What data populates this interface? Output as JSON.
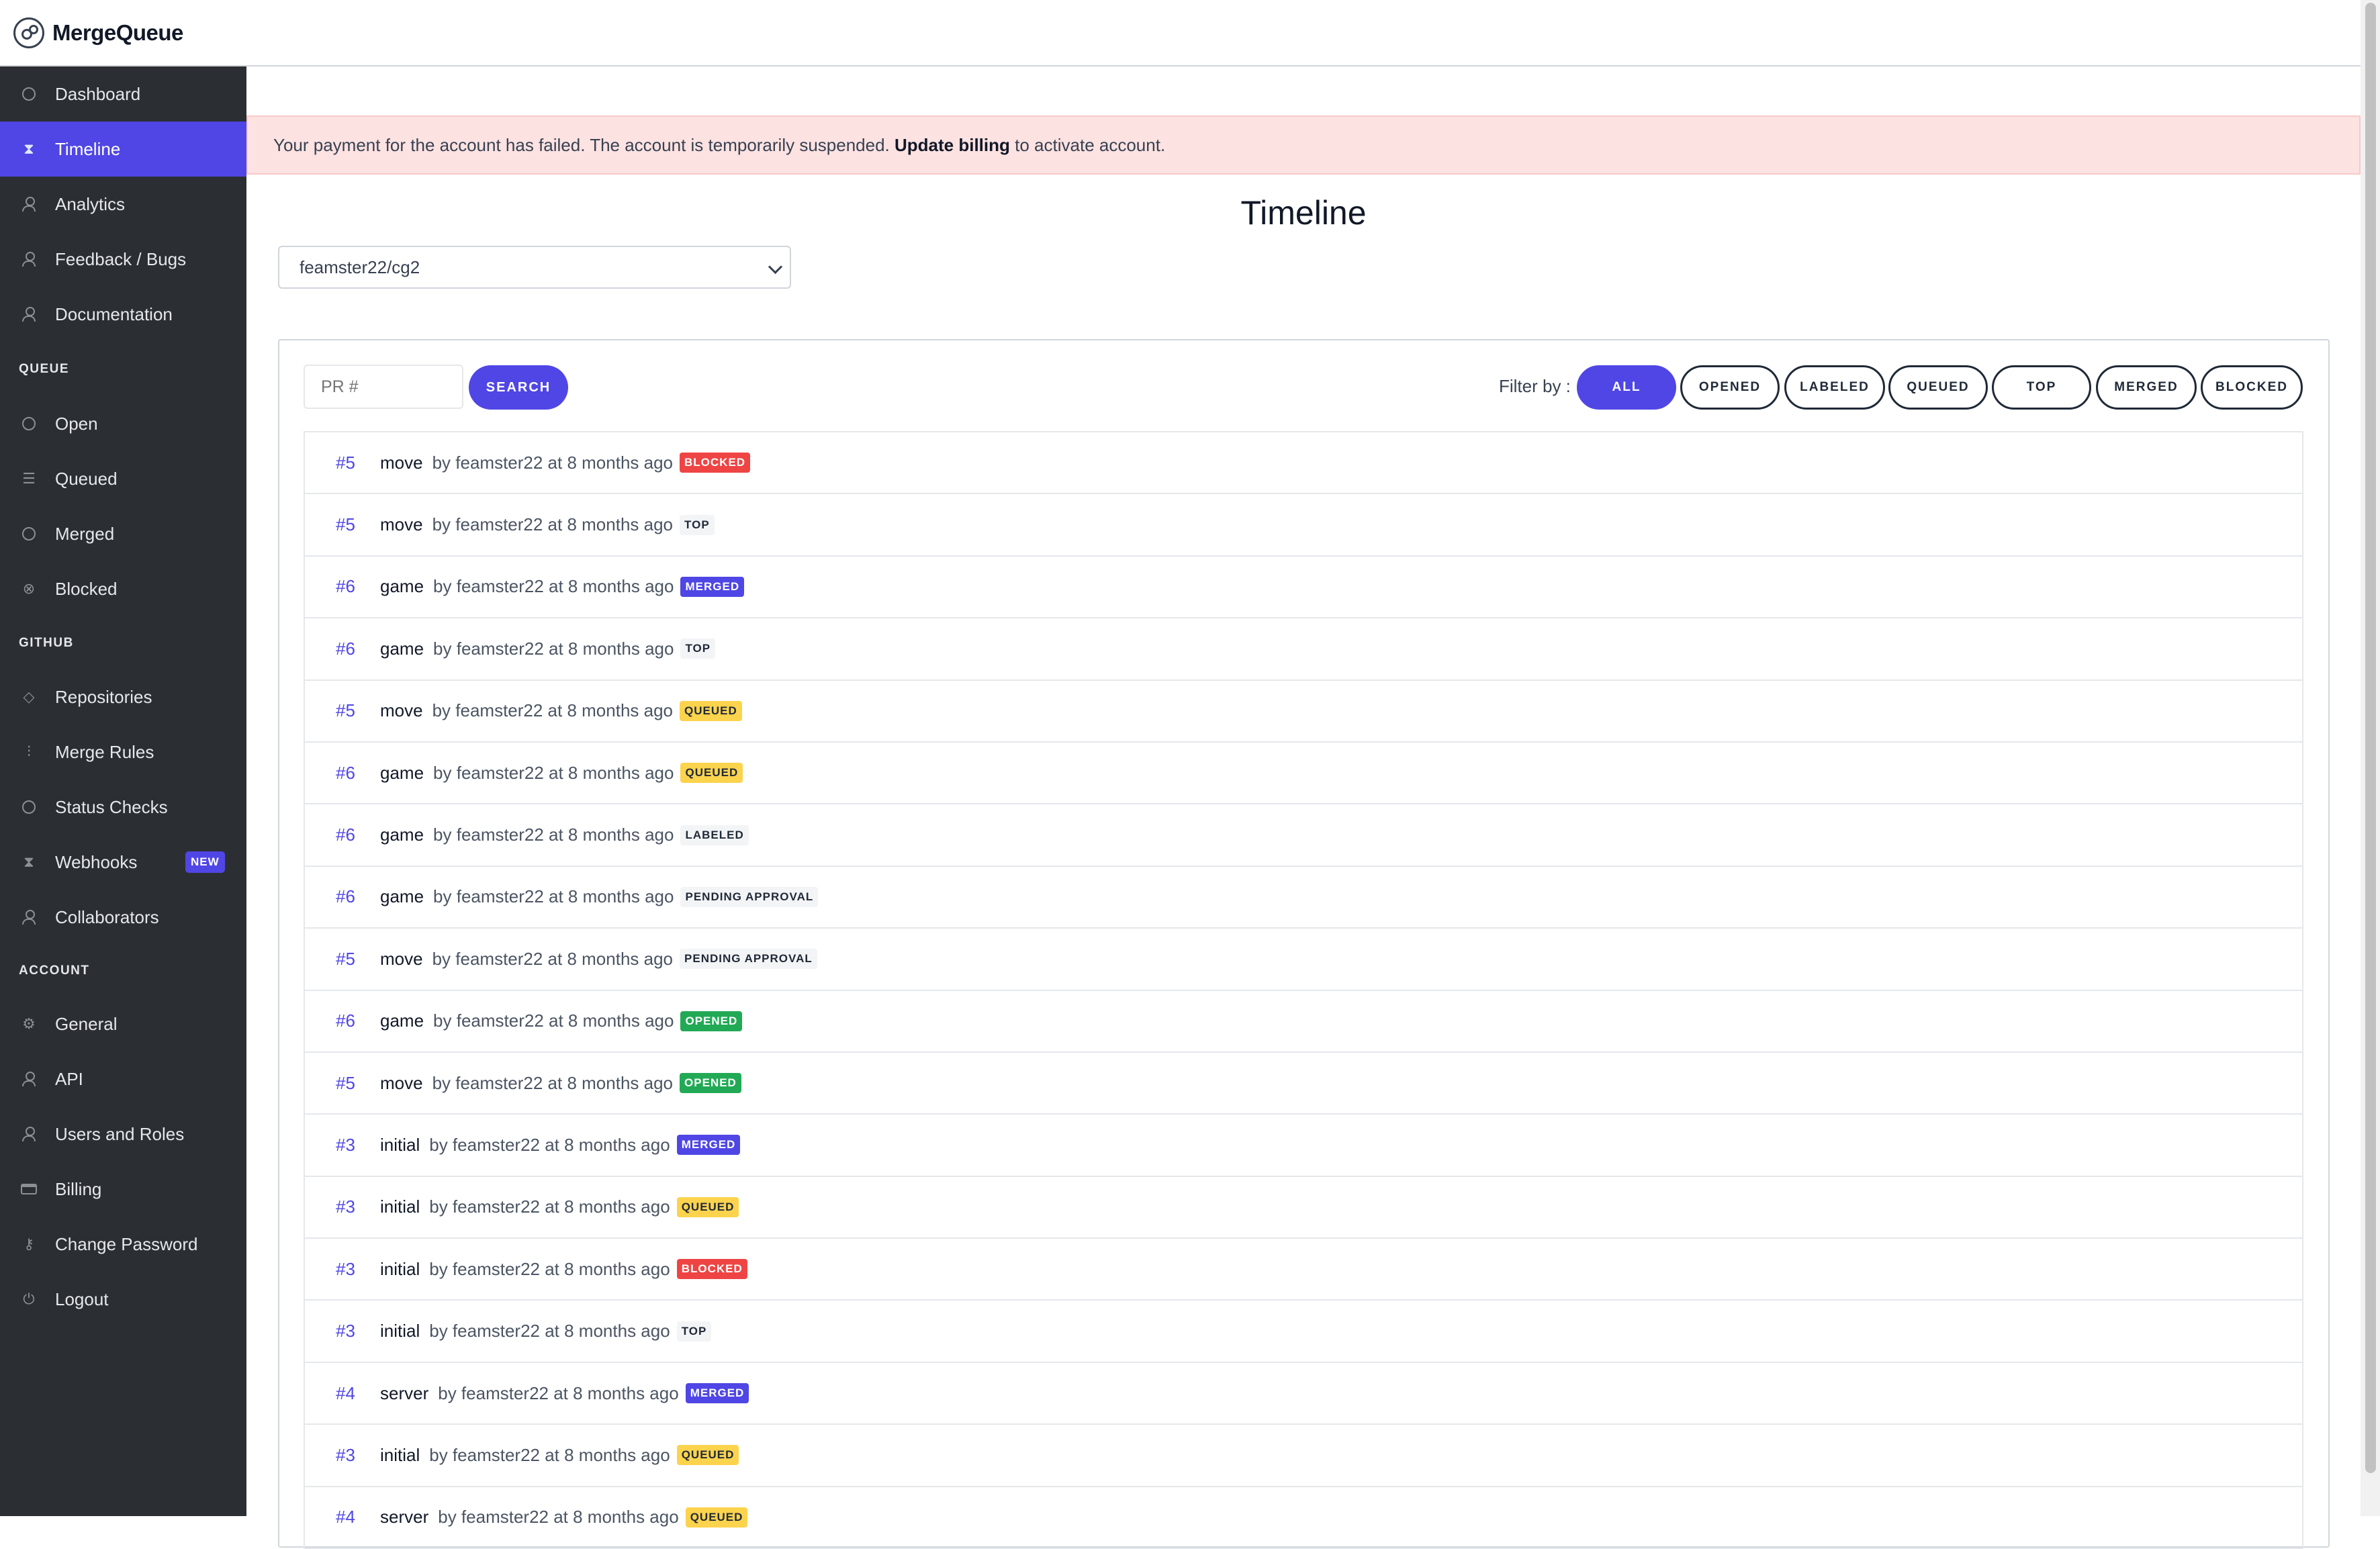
{
  "app": {
    "name": "MergeQueue"
  },
  "sidebar": {
    "items": [
      {
        "label": "Dashboard"
      },
      {
        "label": "Timeline"
      },
      {
        "label": "Analytics"
      },
      {
        "label": "Feedback / Bugs"
      },
      {
        "label": "Documentation"
      },
      {
        "label": "Open"
      },
      {
        "label": "Queued"
      },
      {
        "label": "Merged"
      },
      {
        "label": "Blocked"
      },
      {
        "label": "Repositories"
      },
      {
        "label": "Merge Rules"
      },
      {
        "label": "Status Checks"
      },
      {
        "label": "Webhooks",
        "badge": "NEW"
      },
      {
        "label": "Collaborators"
      },
      {
        "label": "General"
      },
      {
        "label": "API"
      },
      {
        "label": "Users and Roles"
      },
      {
        "label": "Billing"
      },
      {
        "label": "Change Password"
      },
      {
        "label": "Logout"
      }
    ],
    "sections": {
      "queue": "QUEUE",
      "github": "GITHUB",
      "account": "ACCOUNT"
    }
  },
  "alert": {
    "text_before": "Your payment for the account has failed. The account is temporarily suspended.",
    "link": "Update billing",
    "text_after": "to activate account."
  },
  "page": {
    "title": "Timeline"
  },
  "repo_select": {
    "value": "feamster22/cg2"
  },
  "search": {
    "placeholder": "PR #",
    "button": "SEARCH"
  },
  "filter": {
    "label": "Filter by :",
    "options": [
      "ALL",
      "OPENED",
      "LABELED",
      "QUEUED",
      "TOP",
      "MERGED",
      "BLOCKED"
    ],
    "active": "ALL"
  },
  "timeline": [
    {
      "number": "#5",
      "title": "move",
      "meta": "by feamster22 at 8 months ago",
      "status": "BLOCKED"
    },
    {
      "number": "#5",
      "title": "move",
      "meta": "by feamster22 at 8 months ago",
      "status": "TOP"
    },
    {
      "number": "#6",
      "title": "game",
      "meta": "by feamster22 at 8 months ago",
      "status": "MERGED"
    },
    {
      "number": "#6",
      "title": "game",
      "meta": "by feamster22 at 8 months ago",
      "status": "TOP"
    },
    {
      "number": "#5",
      "title": "move",
      "meta": "by feamster22 at 8 months ago",
      "status": "QUEUED"
    },
    {
      "number": "#6",
      "title": "game",
      "meta": "by feamster22 at 8 months ago",
      "status": "QUEUED"
    },
    {
      "number": "#6",
      "title": "game",
      "meta": "by feamster22 at 8 months ago",
      "status": "LABELED"
    },
    {
      "number": "#6",
      "title": "game",
      "meta": "by feamster22 at 8 months ago",
      "status": "PENDING APPROVAL"
    },
    {
      "number": "#5",
      "title": "move",
      "meta": "by feamster22 at 8 months ago",
      "status": "PENDING APPROVAL"
    },
    {
      "number": "#6",
      "title": "game",
      "meta": "by feamster22 at 8 months ago",
      "status": "OPENED"
    },
    {
      "number": "#5",
      "title": "move",
      "meta": "by feamster22 at 8 months ago",
      "status": "OPENED"
    },
    {
      "number": "#3",
      "title": "initial",
      "meta": "by feamster22 at 8 months ago",
      "status": "MERGED"
    },
    {
      "number": "#3",
      "title": "initial",
      "meta": "by feamster22 at 8 months ago",
      "status": "QUEUED"
    },
    {
      "number": "#3",
      "title": "initial",
      "meta": "by feamster22 at 8 months ago",
      "status": "BLOCKED"
    },
    {
      "number": "#3",
      "title": "initial",
      "meta": "by feamster22 at 8 months ago",
      "status": "TOP"
    },
    {
      "number": "#4",
      "title": "server",
      "meta": "by feamster22 at 8 months ago",
      "status": "MERGED"
    },
    {
      "number": "#3",
      "title": "initial",
      "meta": "by feamster22 at 8 months ago",
      "status": "QUEUED"
    },
    {
      "number": "#4",
      "title": "server",
      "meta": "by feamster22 at 8 months ago",
      "status": "QUEUED"
    }
  ],
  "colors": {
    "accent": "#5046e5",
    "sidebar_bg": "#2b2f33",
    "alert_bg": "#fde2e2",
    "blocked": "#ef4444",
    "queued": "#fcd34d",
    "opened": "#22a955"
  }
}
